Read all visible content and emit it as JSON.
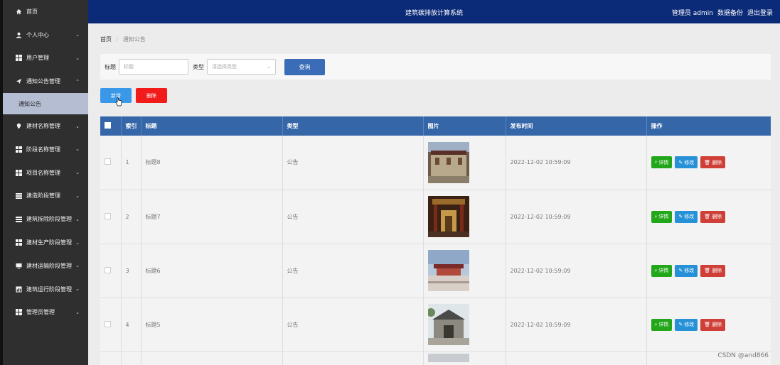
{
  "app": {
    "title": "建筑碳排放计算系统"
  },
  "header": {
    "user": "管理员 admin",
    "backup": "数据备份",
    "logout": "退出登录"
  },
  "sidebar": {
    "items": [
      {
        "label": "首页",
        "icon": "home-icon"
      },
      {
        "label": "个人中心",
        "icon": "user-icon"
      },
      {
        "label": "用户管理",
        "icon": "grid-icon"
      },
      {
        "label": "通知公告管理",
        "icon": "send-icon",
        "expanded": true,
        "sub": "通知公告"
      },
      {
        "label": "建材名称管理",
        "icon": "pin-icon"
      },
      {
        "label": "阶段名称管理",
        "icon": "grid-icon"
      },
      {
        "label": "项目名称管理",
        "icon": "grid-icon"
      },
      {
        "label": "建造阶段管理",
        "icon": "list-icon"
      },
      {
        "label": "建筑拆除阶段管理",
        "icon": "list-icon"
      },
      {
        "label": "建材生产阶段管理",
        "icon": "grid-icon"
      },
      {
        "label": "建材运输阶段管理",
        "icon": "monitor-icon"
      },
      {
        "label": "建筑运行阶段管理",
        "icon": "chart-icon"
      },
      {
        "label": "管理员管理",
        "icon": "grid-icon"
      }
    ]
  },
  "breadcrumb": {
    "home": "首页",
    "current": "通知公告"
  },
  "search": {
    "title_label": "标题",
    "title_placeholder": "标题",
    "type_label": "类型",
    "type_placeholder": "请选择类型",
    "query_button": "查询"
  },
  "actions": {
    "add": "新增",
    "delete": "删除"
  },
  "table": {
    "headers": [
      "索引",
      "标题",
      "类型",
      "图片",
      "发布时间",
      "操作"
    ],
    "rows": [
      {
        "index": "1",
        "title": "标题8",
        "type": "公告",
        "time": "2022-12-02 10:59:09"
      },
      {
        "index": "2",
        "title": "标题7",
        "type": "公告",
        "time": "2022-12-02 10:59:09"
      },
      {
        "index": "3",
        "title": "标题6",
        "type": "公告",
        "time": "2022-12-02 10:59:09"
      },
      {
        "index": "4",
        "title": "标题5",
        "type": "公告",
        "time": "2022-12-02 10:59:09"
      }
    ],
    "op_labels": {
      "detail": "详情",
      "edit": "修改",
      "delete": "删除"
    }
  },
  "watermark": "CSDN @and866"
}
